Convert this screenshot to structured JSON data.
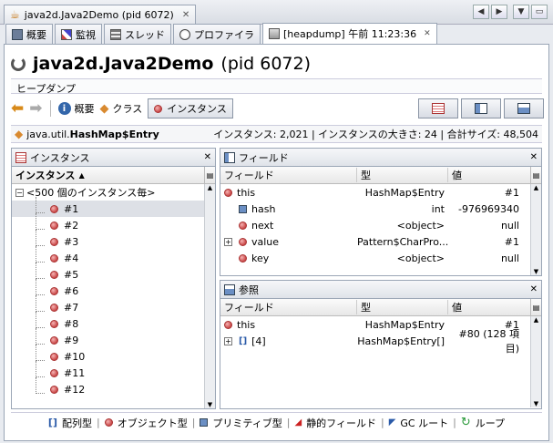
{
  "window": {
    "title": "java2d.Java2Demo (pid 6072)"
  },
  "tabs": [
    {
      "label": "概要",
      "icon": "overview-icon"
    },
    {
      "label": "監視",
      "icon": "monitor-icon"
    },
    {
      "label": "スレッド",
      "icon": "threads-icon"
    },
    {
      "label": "プロファイラ",
      "icon": "profiler-icon"
    },
    {
      "label": "[heapdump] 午前 11:23:36",
      "icon": "heapdump-icon",
      "active": true
    }
  ],
  "header": {
    "title_main": "java2d.Java2Demo",
    "title_pid": "(pid 6072)",
    "subtitle": "ヒープダンプ"
  },
  "toolbar": {
    "summary": "概要",
    "classes": "クラス",
    "instances": "インスタンス"
  },
  "class_bar": {
    "class_prefix": "java.util.",
    "class_name": "HashMap$Entry",
    "stats": "インスタンス: 2,021 | インスタンスの大きさ: 24 | 合計サイズ: 48,504"
  },
  "instances_panel": {
    "title": "インスタンス",
    "column": "インスタンス",
    "group": "<500 個のインスタンス毎>",
    "items": [
      "#1",
      "#2",
      "#3",
      "#4",
      "#5",
      "#6",
      "#7",
      "#8",
      "#9",
      "#10",
      "#11",
      "#12"
    ]
  },
  "fields_panel": {
    "title": "フィールド",
    "columns": [
      "フィールド",
      "型",
      "値"
    ],
    "rows": [
      {
        "name": "this",
        "type": "HashMap$Entry",
        "value": "#1",
        "kind": "object",
        "indent": 0,
        "expand": false
      },
      {
        "name": "hash",
        "type": "int",
        "value": "-976969340",
        "kind": "primitive",
        "indent": 1,
        "expand": false
      },
      {
        "name": "next",
        "type": "<object>",
        "value": "null",
        "kind": "object",
        "indent": 1,
        "expand": false
      },
      {
        "name": "value",
        "type": "Pattern$CharPro...",
        "value": "#1",
        "kind": "object",
        "indent": 1,
        "expand": true
      },
      {
        "name": "key",
        "type": "<object>",
        "value": "null",
        "kind": "object",
        "indent": 1,
        "expand": false
      }
    ]
  },
  "refs_panel": {
    "title": "参照",
    "columns": [
      "フィールド",
      "型",
      "値"
    ],
    "rows": [
      {
        "name": "this",
        "type": "HashMap$Entry",
        "value": "#1",
        "kind": "object",
        "indent": 0,
        "expand": false
      },
      {
        "name": "[4]",
        "type": "HashMap$Entry[]",
        "value": "#80 (128 項目)",
        "kind": "array",
        "indent": 1,
        "expand": true
      }
    ]
  },
  "legend": {
    "array": "配列型",
    "object": "オブジェクト型",
    "primitive": "プリミティブ型",
    "static": "静的フィールド",
    "gcroot": "GC ルート",
    "loop": "ループ"
  },
  "colors": {
    "accent": "#c94848",
    "selected_row": "#dde0e6",
    "panel_border": "#9ba6b6"
  }
}
